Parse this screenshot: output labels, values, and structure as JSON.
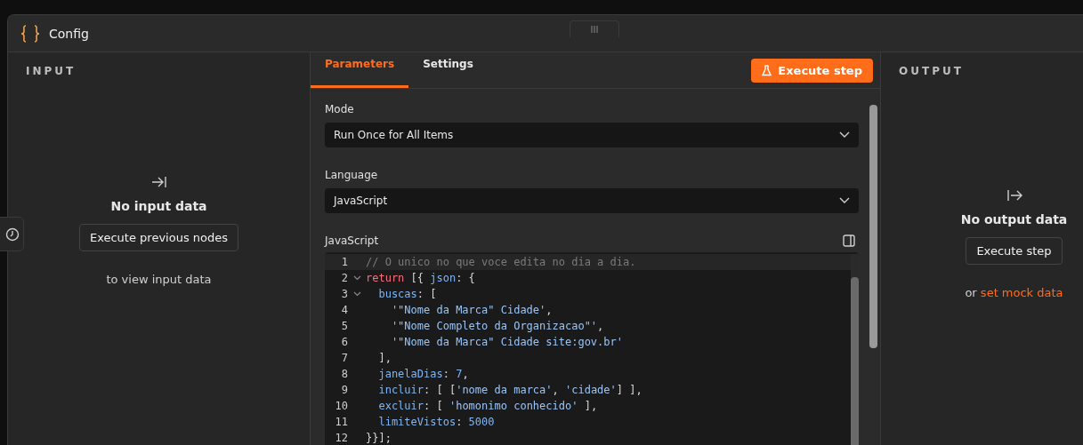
{
  "window": {
    "title": "Config"
  },
  "input_panel": {
    "heading": "INPUT",
    "empty_title": "No input data",
    "button": "Execute previous nodes",
    "hint": "to view input data"
  },
  "tabs": [
    {
      "label": "Parameters",
      "selected": true
    },
    {
      "label": "Settings",
      "selected": false
    }
  ],
  "execute_button": "Execute step",
  "fields": [
    {
      "label": "Mode",
      "value": "Run Once for All Items"
    },
    {
      "label": "Language",
      "value": "JavaScript"
    }
  ],
  "editor": {
    "label": "JavaScript",
    "lines": [
      {
        "number": "1",
        "foldable": false,
        "active": true,
        "tokens": [
          {
            "kind": "comment",
            "text": "// O unico no que voce edita no dia a dia."
          }
        ]
      },
      {
        "number": "2",
        "foldable": true,
        "active": false,
        "tokens": [
          {
            "kind": "keyword",
            "text": "return"
          },
          {
            "kind": "punct",
            "text": " [{ "
          },
          {
            "kind": "prop",
            "text": "json"
          },
          {
            "kind": "punct",
            "text": ": {"
          }
        ]
      },
      {
        "number": "3",
        "foldable": true,
        "active": false,
        "tokens": [
          {
            "kind": "prop",
            "text": "  buscas"
          },
          {
            "kind": "punct",
            "text": ": ["
          }
        ]
      },
      {
        "number": "4",
        "foldable": false,
        "active": false,
        "tokens": [
          {
            "kind": "string",
            "text": "    '\"Nome da Marca\" Cidade'"
          },
          {
            "kind": "punct",
            "text": ","
          }
        ]
      },
      {
        "number": "5",
        "foldable": false,
        "active": false,
        "tokens": [
          {
            "kind": "string",
            "text": "    '\"Nome Completo da Organizacao\"'"
          },
          {
            "kind": "punct",
            "text": ","
          }
        ]
      },
      {
        "number": "6",
        "foldable": false,
        "active": false,
        "tokens": [
          {
            "kind": "string",
            "text": "    '\"Nome da Marca\" Cidade site:gov.br'"
          }
        ]
      },
      {
        "number": "7",
        "foldable": false,
        "active": false,
        "tokens": [
          {
            "kind": "punct",
            "text": "  ],"
          }
        ]
      },
      {
        "number": "8",
        "foldable": false,
        "active": false,
        "tokens": [
          {
            "kind": "prop",
            "text": "  janelaDias"
          },
          {
            "kind": "punct",
            "text": ": "
          },
          {
            "kind": "number",
            "text": "7"
          },
          {
            "kind": "punct",
            "text": ","
          }
        ]
      },
      {
        "number": "9",
        "foldable": false,
        "active": false,
        "tokens": [
          {
            "kind": "prop",
            "text": "  incluir"
          },
          {
            "kind": "punct",
            "text": ": [ ["
          },
          {
            "kind": "string",
            "text": "'nome da marca'"
          },
          {
            "kind": "punct",
            "text": ", "
          },
          {
            "kind": "string",
            "text": "'cidade'"
          },
          {
            "kind": "punct",
            "text": "] ],"
          }
        ]
      },
      {
        "number": "10",
        "foldable": false,
        "active": false,
        "tokens": [
          {
            "kind": "prop",
            "text": "  excluir"
          },
          {
            "kind": "punct",
            "text": ": [ "
          },
          {
            "kind": "string",
            "text": "'homonimo conhecido'"
          },
          {
            "kind": "punct",
            "text": " ],"
          }
        ]
      },
      {
        "number": "11",
        "foldable": false,
        "active": false,
        "tokens": [
          {
            "kind": "prop",
            "text": "  limiteVistos"
          },
          {
            "kind": "punct",
            "text": ": "
          },
          {
            "kind": "number",
            "text": "5000"
          }
        ]
      },
      {
        "number": "12",
        "foldable": false,
        "active": false,
        "tokens": [
          {
            "kind": "punct",
            "text": "}}];"
          }
        ]
      }
    ]
  },
  "output_panel": {
    "heading": "OUTPUT",
    "empty_title": "No output data",
    "button": "Execute step",
    "hint_prefix": "or",
    "hint_link": "set mock data"
  }
}
